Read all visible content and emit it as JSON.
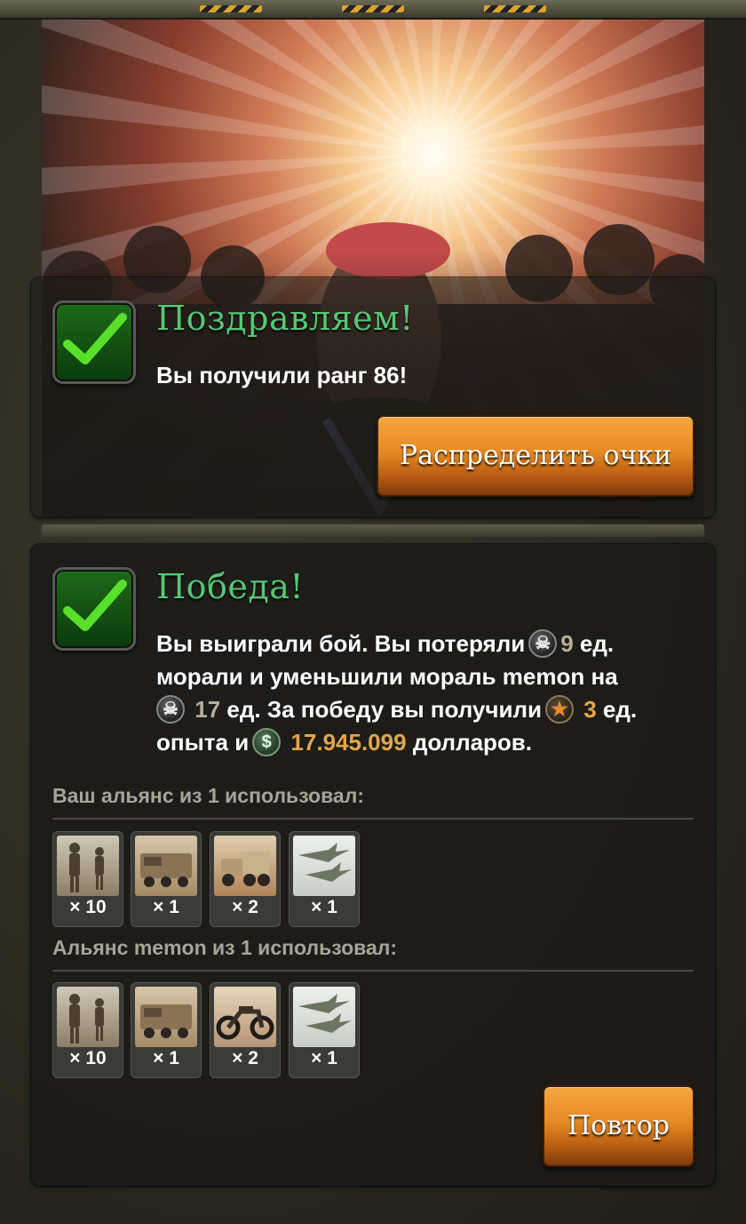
{
  "rank_panel": {
    "title": "Поздравляем!",
    "message": "Вы получили ранг 86!",
    "button_label": "Распределить очки"
  },
  "battle_panel": {
    "title": "Победа!",
    "line1_a": "Вы выиграли бой. Вы потеряли",
    "lost_morale": "9",
    "line1_b": "ед.",
    "line2": "морали и уменьшили мораль memon на",
    "enemy_morale": "17",
    "line3_b": "ед. За победу вы получили",
    "xp": "3",
    "line3_c": "ед.",
    "line4_a": "опыта и",
    "dollars": "17.945.099",
    "line4_b": "долларов.",
    "icons": {
      "morale": "skull-icon",
      "xp": "star-icon",
      "money": "dollar-icon"
    },
    "your_alliance_label": "Ваш альянс из 1 использовал:",
    "your_units": [
      {
        "type": "infantry",
        "count": "× 10"
      },
      {
        "type": "armored-vehicle",
        "count": "× 1"
      },
      {
        "type": "truck",
        "count": "× 2"
      },
      {
        "type": "jets",
        "count": "× 1"
      }
    ],
    "enemy_alliance_label": "Альянс memon из 1 использовал:",
    "enemy_units": [
      {
        "type": "infantry",
        "count": "× 10"
      },
      {
        "type": "armored-vehicle",
        "count": "× 1"
      },
      {
        "type": "motorcycle",
        "count": "× 2"
      },
      {
        "type": "jets",
        "count": "× 1"
      }
    ],
    "repeat_button_label": "Повтор"
  },
  "colors": {
    "heading_green": "#57c774",
    "accent_gold": "#e3a649",
    "button_orange": "#e68a23"
  }
}
